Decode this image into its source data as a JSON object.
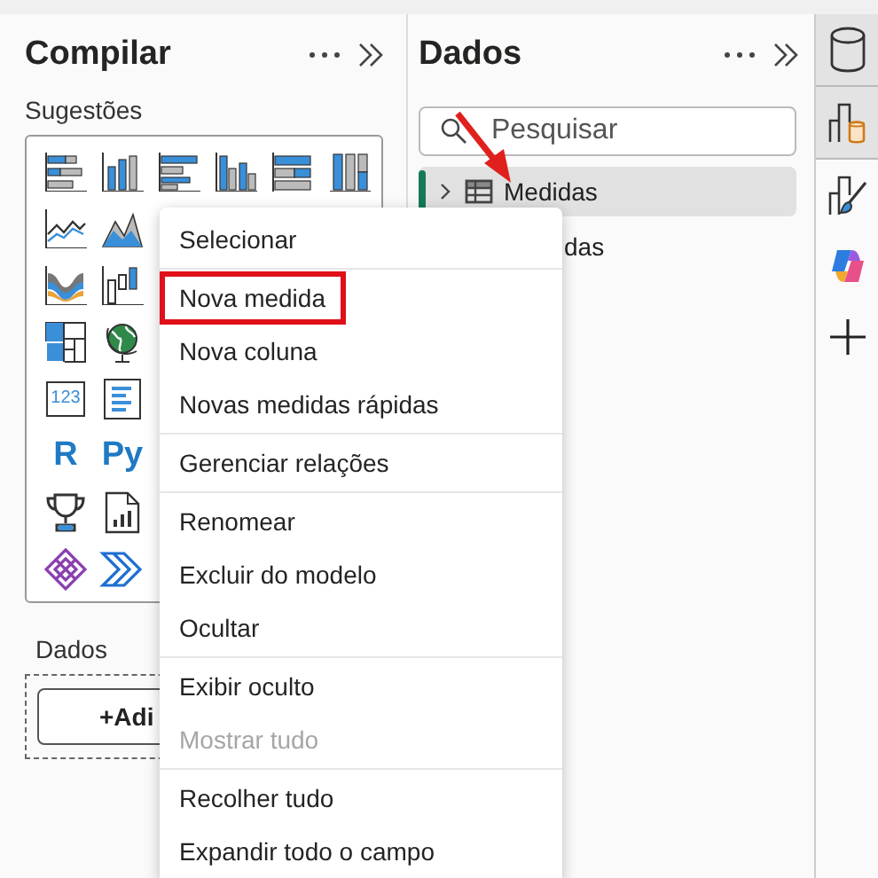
{
  "build_pane": {
    "title": "Compilar",
    "suggestions_label": "Sugestões",
    "visuals": [
      {
        "kind": "stacked-bar"
      },
      {
        "kind": "stacked-column"
      },
      {
        "kind": "clustered-bar"
      },
      {
        "kind": "clustered-column"
      },
      {
        "kind": "bar-100"
      },
      {
        "kind": "column-100"
      },
      {
        "kind": "line"
      },
      {
        "kind": "area"
      },
      {
        "kind": "ribbon"
      },
      {
        "kind": "waterfall"
      },
      {
        "kind": "treemap"
      },
      {
        "kind": "globe"
      },
      {
        "kind": "card",
        "label": "123"
      },
      {
        "kind": "multirow"
      },
      {
        "kind": "letter",
        "label": "R"
      },
      {
        "kind": "letter",
        "label": "Py"
      },
      {
        "kind": "trophy"
      },
      {
        "kind": "report"
      },
      {
        "kind": "diamond"
      },
      {
        "kind": "chevrons"
      }
    ],
    "data_label": "Dados",
    "add_button": "+Adi"
  },
  "data_pane": {
    "title": "Dados",
    "search": {
      "placeholder": "Pesquisar"
    },
    "tree": [
      {
        "label": "Medidas",
        "kind": "table",
        "selected": true,
        "expanded": false
      },
      {
        "label": "das",
        "kind": "clipped",
        "selected": false
      }
    ]
  },
  "rail": [
    {
      "kind": "database",
      "selected": true
    },
    {
      "kind": "chart-db",
      "selected": true
    },
    {
      "kind": "brush",
      "selected": false
    },
    {
      "kind": "copilot",
      "selected": false
    },
    {
      "kind": "plus",
      "selected": false
    }
  ],
  "context_menu": {
    "groups": [
      [
        {
          "label": "Selecionar",
          "disabled": false,
          "highlighted": false
        }
      ],
      [
        {
          "label": "Nova medida",
          "disabled": false,
          "highlighted": true
        },
        {
          "label": "Nova coluna",
          "disabled": false,
          "highlighted": false
        },
        {
          "label": "Novas medidas rápidas",
          "disabled": false,
          "highlighted": false
        }
      ],
      [
        {
          "label": "Gerenciar relações",
          "disabled": false,
          "highlighted": false
        }
      ],
      [
        {
          "label": "Renomear",
          "disabled": false,
          "highlighted": false
        },
        {
          "label": "Excluir do modelo",
          "disabled": false,
          "highlighted": false
        },
        {
          "label": "Ocultar",
          "disabled": false,
          "highlighted": false
        }
      ],
      [
        {
          "label": "Exibir oculto",
          "disabled": false,
          "highlighted": false
        },
        {
          "label": "Mostrar tudo",
          "disabled": true,
          "highlighted": false
        }
      ],
      [
        {
          "label": "Recolher tudo",
          "disabled": false,
          "highlighted": false
        },
        {
          "label": "Expandir todo o campo",
          "disabled": false,
          "highlighted": false
        }
      ]
    ]
  }
}
